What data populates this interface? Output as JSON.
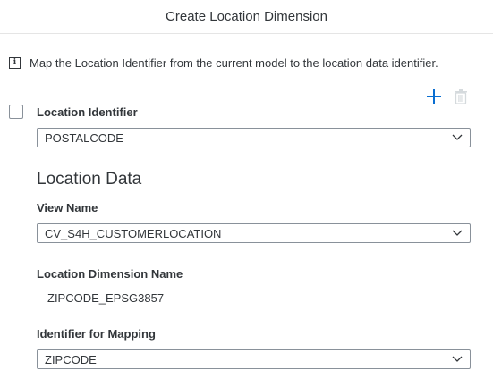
{
  "dialog": {
    "title": "Create Location Dimension"
  },
  "info": {
    "text": "Map the Location Identifier from the current model to the location data identifier.",
    "icon": "info-icon"
  },
  "toolbar": {
    "add_icon": "plus-icon",
    "delete_icon": "trash-icon"
  },
  "location_identifier": {
    "label": "Location Identifier",
    "checked": false,
    "value": "POSTALCODE"
  },
  "location_data": {
    "title": "Location Data",
    "view_name": {
      "label": "View Name",
      "value": "CV_S4H_CUSTOMERLOCATION"
    },
    "dimension_name": {
      "label": "Location Dimension Name",
      "value": "ZIPCODE_EPSG3857"
    },
    "identifier_for_mapping": {
      "label": "Identifier for Mapping",
      "value": "ZIPCODE"
    }
  },
  "colors": {
    "accent": "#0a6ed1",
    "disabled_icon": "#d5dadd",
    "border": "#89919a",
    "text": "#32363a"
  }
}
